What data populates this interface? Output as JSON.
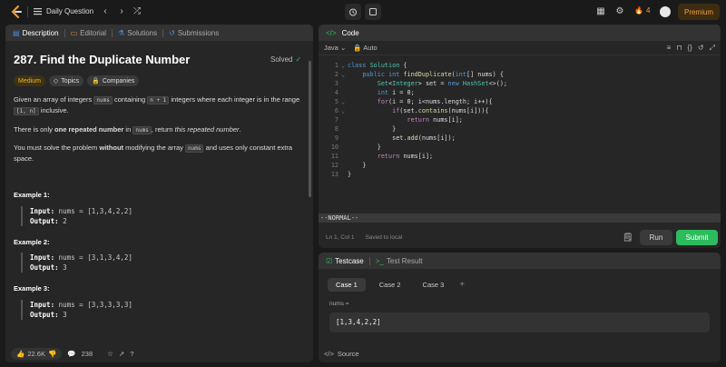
{
  "topbar": {
    "title": "Daily Question",
    "streak_count": "4",
    "premium_label": "Premium"
  },
  "left_panel": {
    "tabs": [
      {
        "label": "Description"
      },
      {
        "label": "Editorial"
      },
      {
        "label": "Solutions"
      },
      {
        "label": "Submissions"
      }
    ],
    "problem_title": "287. Find the Duplicate Number",
    "status": "Solved",
    "difficulty": "Medium",
    "topics_label": "Topics",
    "companies_label": "Companies",
    "desc1_a": "Given an array of integers",
    "desc1_code1": "nums",
    "desc1_b": "containing",
    "desc1_code2": "n + 1",
    "desc1_c": "integers where each integer is in the range",
    "desc1_code3": "[1, n]",
    "desc1_d": "inclusive.",
    "desc2_a": "There is only",
    "desc2_bold": "one repeated number",
    "desc2_b": "in",
    "desc2_code": "nums",
    "desc2_c": ", return",
    "desc2_italic": "this repeated number",
    "desc2_d": ".",
    "desc3_a": "You must solve the problem",
    "desc3_bold": "without",
    "desc3_b": "modifying the array",
    "desc3_code": "nums",
    "desc3_c": "and uses only constant extra space.",
    "examples": [
      {
        "title": "Example 1:",
        "input_label": "Input:",
        "input": "nums = [1,3,4,2,2]",
        "output_label": "Output:",
        "output": "2"
      },
      {
        "title": "Example 2:",
        "input_label": "Input:",
        "input": "nums = [3,1,3,4,2]",
        "output_label": "Output:",
        "output": "3"
      },
      {
        "title": "Example 3:",
        "input_label": "Input:",
        "input": "nums = [3,3,3,3,3]",
        "output_label": "Output:",
        "output": "3"
      }
    ],
    "likes": "22.6K",
    "comments": "238"
  },
  "code_panel": {
    "title": "Code",
    "language": "Java",
    "autocomplete": "Auto",
    "lines": [
      "class Solution {",
      "    public int findDuplicate(int[] nums) {",
      "        Set<Integer> set = new HashSet<>();",
      "        int i = 0;",
      "        for(i = 0; i<nums.length; i++){",
      "            if(set.contains(nums[i])){",
      "                return nums[i];",
      "            }",
      "            set.add(nums[i]);",
      "        }",
      "        return nums[i];",
      "    }",
      "}"
    ],
    "vim_mode": "--NORMAL--",
    "cursor_pos": "Ln 1, Col 1",
    "save_status": "Saved to local",
    "run_label": "Run",
    "submit_label": "Submit"
  },
  "test_panel": {
    "tab_testcase": "Testcase",
    "tab_result": "Test Result",
    "cases": [
      "Case 1",
      "Case 2",
      "Case 3"
    ],
    "input_label": "nums =",
    "input_value": "[1,3,4,2,2]",
    "source_label": "Source"
  },
  "colors": {
    "accent_green": "#2cbb5d",
    "medium": "#f0b429",
    "premium": "#f0a040"
  }
}
